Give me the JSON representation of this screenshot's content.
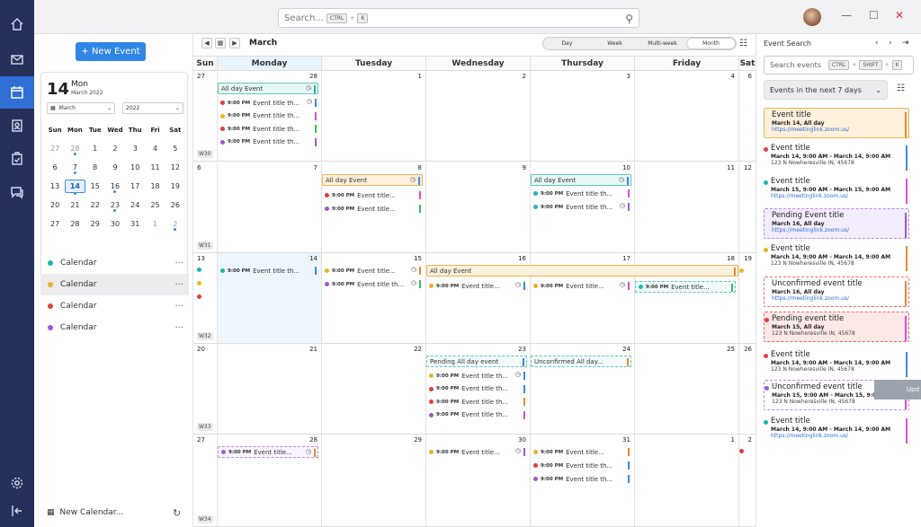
{
  "topbar": {
    "search_placeholder": "Search...",
    "kbd_ctrl": "CTRL",
    "kbd_k": "K",
    "min_glyph": "—",
    "max_glyph": "☐",
    "close_glyph": "✕"
  },
  "left": {
    "new_event_label": "+ New Event",
    "mini": {
      "day": "14",
      "dow": "Mon",
      "month_year": "March 2022",
      "month_sel": "March",
      "year_sel": "2022",
      "heads": [
        "Sun",
        "Mon",
        "Tue",
        "Wed",
        "Thu",
        "Fri",
        "Sat"
      ],
      "rows": [
        [
          "27",
          "28",
          "1",
          "2",
          "3",
          "4",
          "5"
        ],
        [
          "6",
          "7",
          "8",
          "9",
          "10",
          "11",
          "12"
        ],
        [
          "13",
          "14",
          "15",
          "16",
          "17",
          "18",
          "19"
        ],
        [
          "20",
          "21",
          "22",
          "23",
          "24",
          "25",
          "26"
        ],
        [
          "27",
          "28",
          "29",
          "30",
          "31",
          "1",
          "2"
        ]
      ]
    },
    "calendars": [
      {
        "label": "Calendar",
        "color": "#1fb6b0"
      },
      {
        "label": "Calendar",
        "color": "#e8b520"
      },
      {
        "label": "Calendar",
        "color": "#e33d3d"
      },
      {
        "label": "Calendar",
        "color": "#9b59d9"
      }
    ],
    "more": "···",
    "new_calendar_label": "New Calendar..."
  },
  "calendar": {
    "month_label": "March",
    "views": [
      "Day",
      "Week",
      "Multi-week",
      "Month"
    ],
    "dows": [
      "Sun",
      "Monday",
      "Tuesday",
      "Wednesday",
      "Thursday",
      "Friday",
      "Sat"
    ],
    "weeks": [
      {
        "wk": "W30",
        "days": [
          "27",
          "28",
          "1",
          "2",
          "3",
          "4",
          "6"
        ]
      },
      {
        "wk": "W31",
        "days": [
          "6",
          "7",
          "8",
          "9",
          "10",
          "11",
          "12"
        ]
      },
      {
        "wk": "W32",
        "days": [
          "13",
          "14",
          "15",
          "16",
          "17",
          "18",
          "19"
        ]
      },
      {
        "wk": "W33",
        "days": [
          "20",
          "21",
          "22",
          "23",
          "24",
          "25",
          "26"
        ]
      },
      {
        "wk": "W34",
        "days": [
          "27",
          "28",
          "29",
          "30",
          "31",
          "1",
          "2"
        ]
      }
    ],
    "all_day": "All day Event",
    "event_title": "Event title th...",
    "event_title_short": "Event title...",
    "time": "9:00 PM",
    "pending_all_day": "Pending All day event",
    "unconfirmed_all_day": "Unconfirmed All day..."
  },
  "search": {
    "title": "Event Search",
    "placeholder": "Search events",
    "kbd_ctrl": "CTRL",
    "kbd_shift": "SHIFT",
    "kbd_k": "K",
    "filter": "Events in the next 7 days",
    "results": [
      {
        "title": "Event title",
        "line": "March 14, All day",
        "sub": "https://meetinglink.zoom.us/"
      },
      {
        "title": "Event title",
        "line": "March 14, 9:00 AM - March 14, 9:00 AM",
        "sub": "123 N Nowheresville IN, 45678"
      },
      {
        "title": "Event title",
        "line": "March 15, 9:00 AM - March 15, 9:00 AM",
        "sub": "https://meetinglink.zoom.us/"
      },
      {
        "title": "Pending Event title",
        "line": "March 16, All day",
        "sub": "https://meetinglink.zoom.us/"
      },
      {
        "title": "Event title",
        "line": "March 14, 9:00 AM - March 14, 9:00 AM",
        "sub": "123 N Nowheresville IN, 45678"
      },
      {
        "title": "Unconfirmed event title",
        "line": "March 16, All day",
        "sub": "https://meetinglink.zoom.us/"
      },
      {
        "title": "Pending event title",
        "line": "March 15, All day",
        "sub": "123 N Nowheresville IN, 45678"
      },
      {
        "title": "Event title",
        "line": "March 14, 9:00 AM - March 14, 9:00 AM",
        "sub": "123 N Nowheresville IN, 45678"
      },
      {
        "title": "Unconfirmed event title",
        "line": "March 15, 9:00 AM - March 15, 9:00 AM",
        "sub": "123 N Nowheresville IN, 45678"
      },
      {
        "title": "Event title",
        "line": "March 14, 9:00 AM - March 14, 9:00 AM",
        "sub": "https://meetinglink.zoom.us/"
      }
    ]
  },
  "toast": "Upd",
  "colors": {
    "accent": "#2f86e6",
    "teal": "#1fb6b0",
    "yellow": "#e8b520",
    "red": "#e33d3d",
    "purple": "#9b59d9",
    "green": "#3cc05c",
    "orange": "#f08a2a",
    "blue": "#3b8ae6",
    "pink": "#e04fd0",
    "nav": "#26305a"
  }
}
